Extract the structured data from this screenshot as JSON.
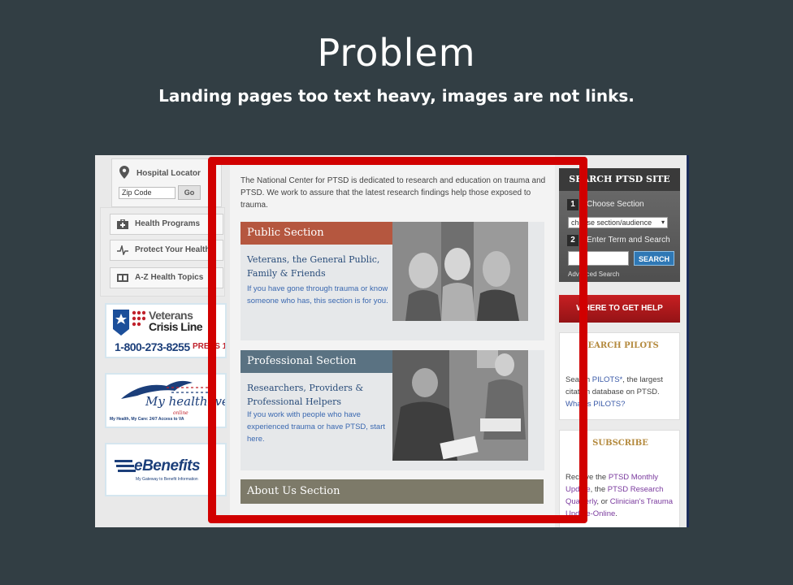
{
  "slide": {
    "title": "Problem",
    "subtitle": "Landing pages too text heavy, images are not links."
  },
  "left_sidebar": {
    "locator_title": "Hospital Locator",
    "zip_placeholder": "Zip Code",
    "go_label": "Go",
    "nav": [
      {
        "label": "Health Programs",
        "icon": "first-aid-kit-icon"
      },
      {
        "label": "Protect Your Health",
        "icon": "heartbeat-icon"
      },
      {
        "label": "A-Z Health Topics",
        "icon": "book-icon"
      }
    ],
    "crisis_line": {
      "title_line1": "Veterans",
      "title_line2": "Crisis Line",
      "phone": "1-800-273-8255",
      "press": "PRESS 1"
    },
    "myhealthevet": {
      "title": "My healthevet",
      "online": "online",
      "tagline": "My Health, My Care: 24/7 Access to VA"
    },
    "ebenefits": {
      "title": "eBenefits",
      "tagline": "My Gateway to Benefit Information"
    }
  },
  "main": {
    "intro": "The National Center for PTSD is dedicated to research and education on trauma and PTSD. We work to assure that the latest research findings help those exposed to trauma.",
    "sections": [
      {
        "title": "Public Section",
        "link_text": "Veterans, the General Public, Family & Friends",
        "description": "If you have gone through trauma or know someone who has, this section is for you.",
        "head_color": "#b5573f"
      },
      {
        "title": "Professional Section",
        "link_text": "Researchers, Providers & Professional Helpers",
        "description": "If you work with people who have experienced trauma or have PTSD, start here.",
        "head_color": "#5a7282"
      }
    ],
    "about_title": "About Us Section"
  },
  "right_sidebar": {
    "search_title": "SEARCH PTSD SITE",
    "step1": "Choose Section",
    "select_value": "choose section/audience",
    "step2": "Enter Term and Search",
    "search_button": "SEARCH",
    "advanced": "Advanced Search",
    "help_button": "WHERE TO GET HELP",
    "pilots": {
      "title": "SEARCH PILOTS",
      "text_a": "Search ",
      "link_a": "PILOTS*",
      "text_b": ", the largest citation database on PTSD. ",
      "link_b": "What is PILOTS?"
    },
    "subscribe": {
      "title": "SUBSCRIBE",
      "text_a": "Receive the ",
      "link_a": "PTSD Monthly Update",
      "text_b": ", the ",
      "link_b": "PTSD Research Quarterly",
      "text_c": ", or ",
      "link_c": "Clinician's Trauma Update-Online",
      "text_d": "."
    }
  },
  "colors": {
    "slide_background": "#323e44",
    "highlight_frame": "#d10000",
    "help_button": "#b3191c",
    "search_button": "#2f78b5"
  }
}
